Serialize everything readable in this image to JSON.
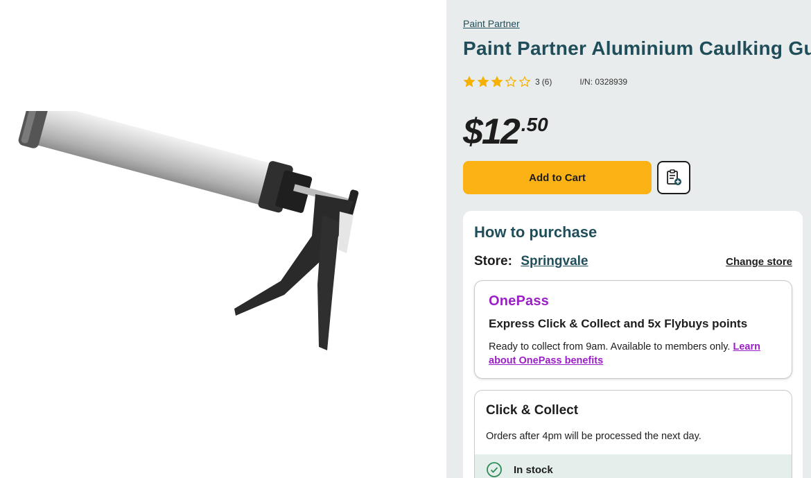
{
  "product": {
    "brand": "Paint Partner",
    "title": "Paint Partner Aluminium Caulking Gun",
    "rating": 3,
    "rating_max": 5,
    "rating_value_label": "3",
    "review_count_label": "(6)",
    "item_number": "I/N: 0328939",
    "price_dollars": "$12",
    "price_cents": ".50"
  },
  "actions": {
    "add_to_cart_label": "Add to Cart",
    "list_icon": "add-to-list-icon"
  },
  "purchase": {
    "title": "How to purchase",
    "store_label": "Store:",
    "store_name": "Springvale",
    "change_store_label": "Change store"
  },
  "onepass": {
    "logo_text": "OnePass",
    "heading": "Express Click & Collect and 5x Flybuys points",
    "description": "Ready to collect from 9am. Available to members only.",
    "link_text": "Learn about OnePass benefits"
  },
  "click_collect": {
    "title": "Click & Collect",
    "note": "Orders after 4pm will be processed the next day.",
    "stock_label": "In stock"
  },
  "colors": {
    "brand_teal": "#1f4e5a",
    "cart_yellow": "#fbb214",
    "onepass_purple": "#9a1fc6",
    "star_gold": "#f5b000",
    "stock_green": "#2e8b57"
  }
}
